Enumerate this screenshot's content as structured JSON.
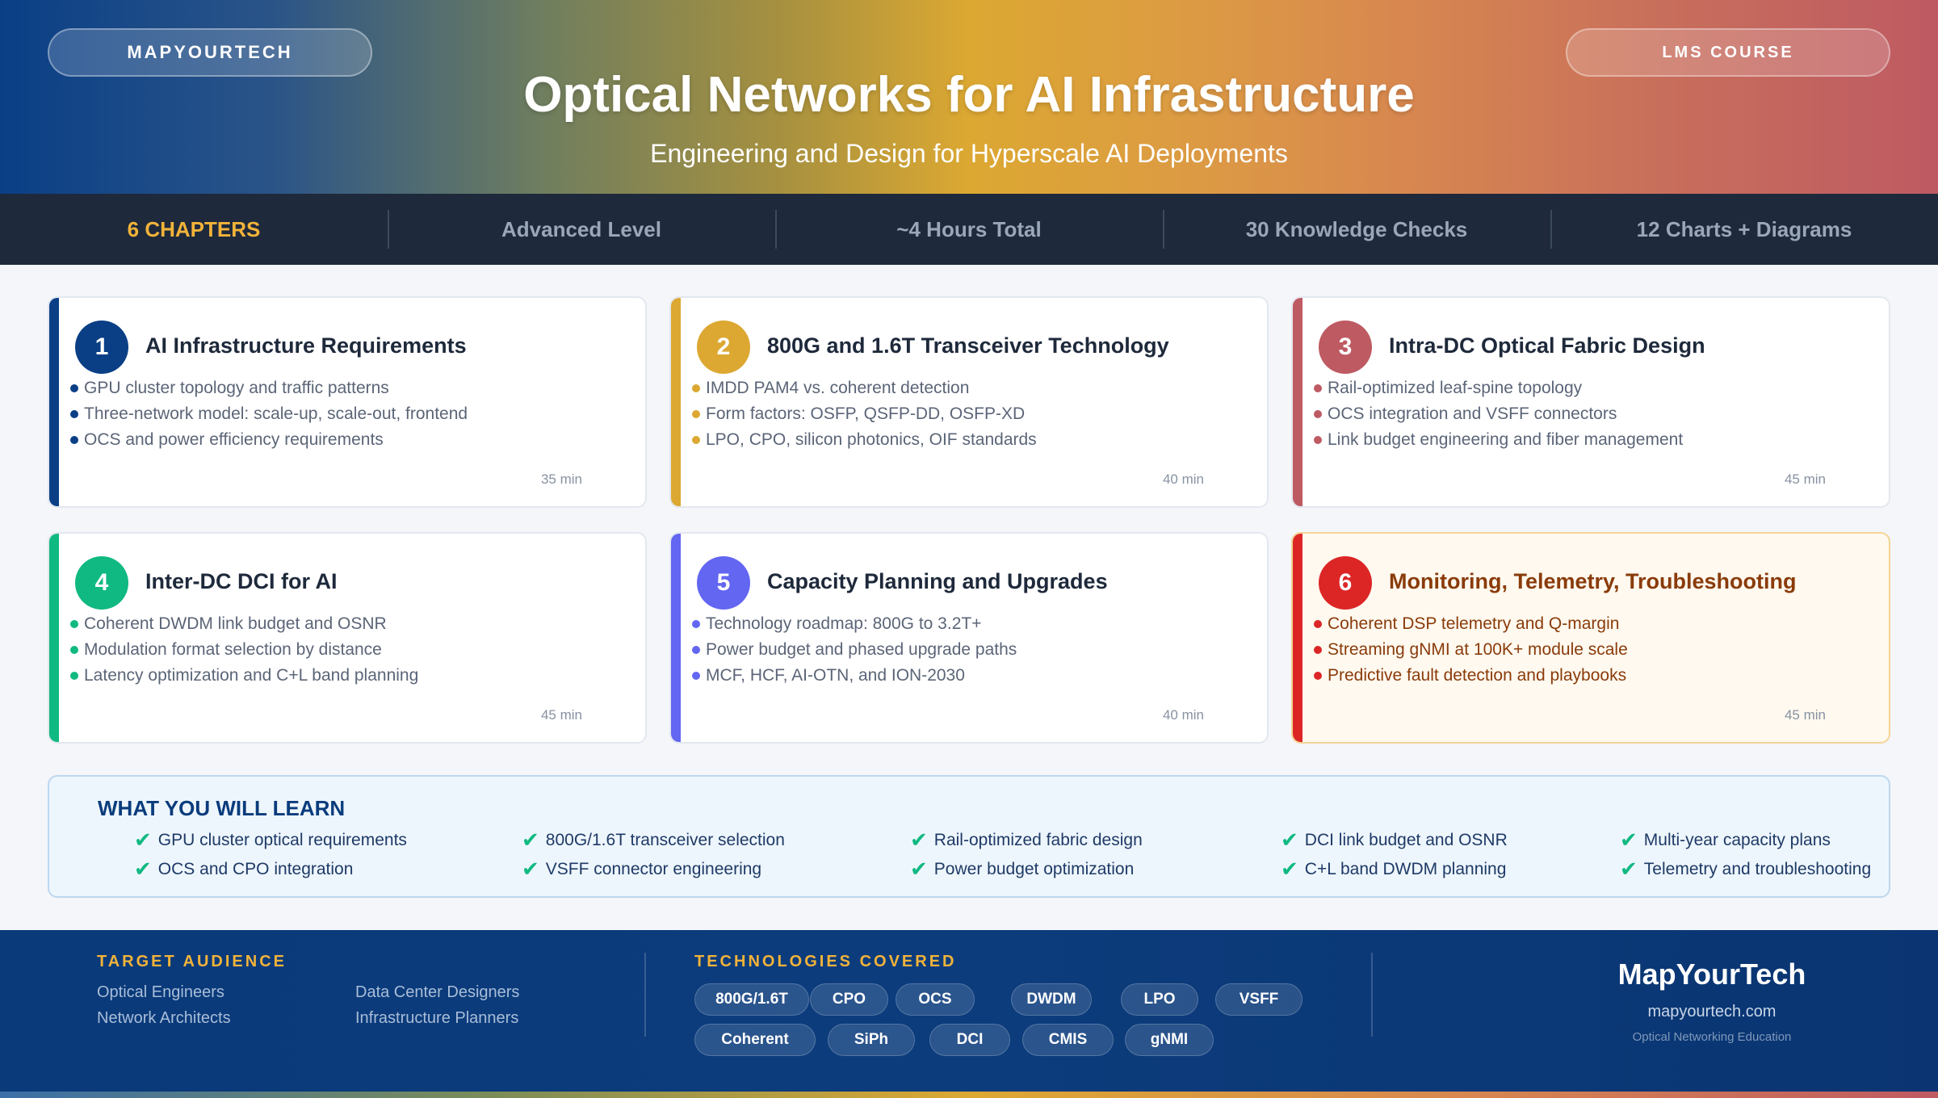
{
  "header": {
    "brand_pill": "MAPYOURTECH",
    "course_pill": "LMS COURSE",
    "title": "Optical Networks for AI Infrastructure",
    "subtitle": "Engineering and Design for Hyperscale AI Deployments"
  },
  "stats": [
    "6 CHAPTERS",
    "Advanced Level",
    "~4 Hours Total",
    "30 Knowledge Checks",
    "12 Charts + Diagrams"
  ],
  "chapters": [
    {
      "number": "1",
      "title": "AI Infrastructure Requirements",
      "color": "#0a3f86",
      "topics": [
        "GPU cluster topology and traffic patterns",
        "Three-network model: scale-up, scale-out, frontend",
        "OCS and power efficiency requirements"
      ],
      "duration": "35 min"
    },
    {
      "number": "2",
      "title": "800G and 1.6T Transceiver Technology",
      "color": "#dca832",
      "topics": [
        "IMDD PAM4 vs. coherent detection",
        "Form factors: OSFP, QSFP-DD, OSFP-XD",
        "LPO, CPO, silicon photonics, OIF standards"
      ],
      "duration": "40 min"
    },
    {
      "number": "3",
      "title": "Intra-DC Optical Fabric Design",
      "color": "#be5a62",
      "topics": [
        "Rail-optimized leaf-spine topology",
        "OCS integration and VSFF connectors",
        "Link budget engineering and fiber management"
      ],
      "duration": "45 min"
    },
    {
      "number": "4",
      "title": "Inter-DC DCI for AI",
      "color": "#10b981",
      "topics": [
        "Coherent DWDM link budget and OSNR",
        "Modulation format selection by distance",
        "Latency optimization and C+L band planning"
      ],
      "duration": "45 min"
    },
    {
      "number": "5",
      "title": "Capacity Planning and Upgrades",
      "color": "#6366f1",
      "topics": [
        "Technology roadmap: 800G to 3.2T+",
        "Power budget and phased upgrade paths",
        "MCF, HCF, AI-OTN, and ION-2030"
      ],
      "duration": "40 min"
    },
    {
      "number": "6",
      "title": "Monitoring, Telemetry, Troubleshooting",
      "color": "#dc2626",
      "topics": [
        "Coherent DSP telemetry and Q-margin",
        "Streaming gNMI at 100K+ module scale",
        "Predictive fault detection and playbooks"
      ],
      "duration": "45 min"
    }
  ],
  "learn": {
    "title": "WHAT YOU WILL LEARN",
    "items": [
      "GPU cluster optical requirements",
      "800G/1.6T transceiver selection",
      "Rail-optimized fabric design",
      "DCI link budget and OSNR",
      "Multi-year capacity plans",
      "OCS and CPO integration",
      "VSFF connector engineering",
      "Power budget optimization",
      "C+L band DWDM planning",
      "Telemetry and troubleshooting"
    ]
  },
  "footer": {
    "audience_label": "TARGET AUDIENCE",
    "audience": [
      "Optical Engineers",
      "Data Center Designers",
      "Network Architects",
      "Infrastructure Planners"
    ],
    "tech_label": "TECHNOLOGIES COVERED",
    "technologies": [
      "800G/1.6T",
      "CPO",
      "OCS",
      "DWDM",
      "LPO",
      "VSFF",
      "Coherent",
      "SiPh",
      "DCI",
      "CMIS",
      "gNMI"
    ],
    "brand_name": "MapYourTech",
    "brand_url": "mapyourtech.com",
    "brand_tagline": "Optical Networking Education"
  }
}
